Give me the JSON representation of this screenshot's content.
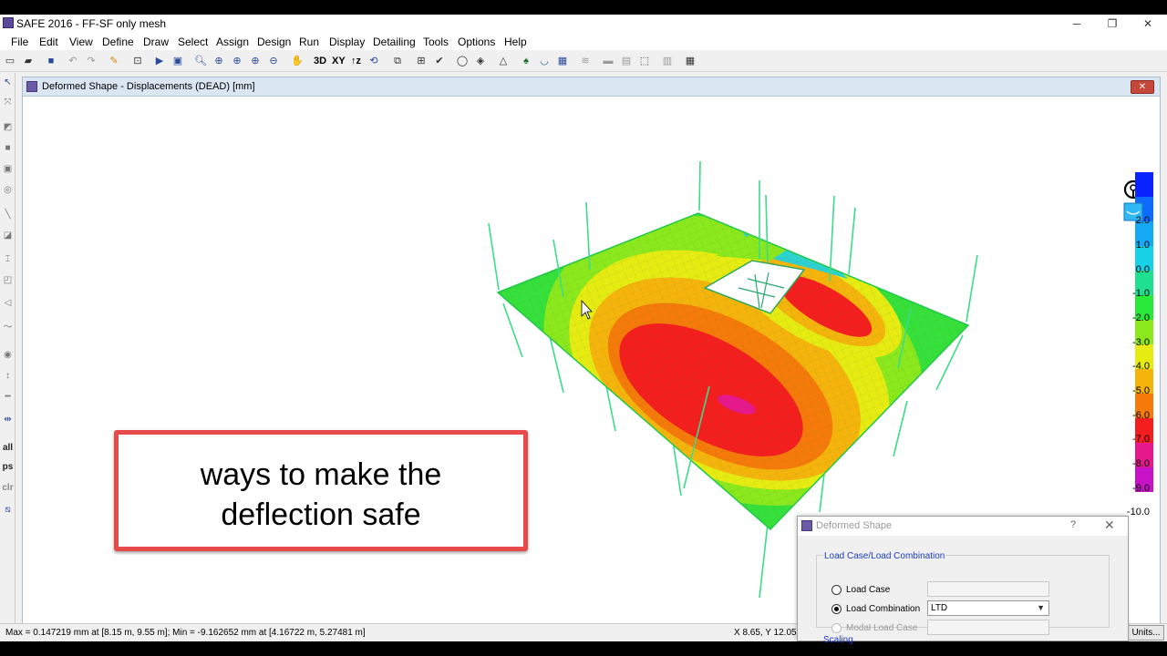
{
  "window": {
    "title": "SAFE 2016 - FF-SF only mesh",
    "minimize": "─",
    "restore": "❐",
    "close": "✕"
  },
  "menu": [
    "File",
    "Edit",
    "View",
    "Define",
    "Draw",
    "Select",
    "Assign",
    "Design",
    "Run",
    "Display",
    "Detailing",
    "Tools",
    "Options",
    "Help"
  ],
  "toolbar": {
    "view_3d": "3D",
    "view_xy": "XY",
    "view_xz": "↑z"
  },
  "left_toolbar": {
    "all": "all",
    "ps": "ps",
    "clr": "clr"
  },
  "view_window": {
    "title": "Deformed Shape - Displacements (DEAD)  [mm]",
    "close": "✕"
  },
  "legend": {
    "labels": [
      "2.0",
      "1.0",
      "0.0",
      "-1.0",
      "-2.0",
      "-3.0",
      "-4.0",
      "-5.0",
      "-6.0",
      "-7.0",
      "-8.0",
      "-9.0",
      "-10.0"
    ],
    "colors": [
      "#0b24ff",
      "#0d6cff",
      "#14a8f5",
      "#17d2e6",
      "#1ee08f",
      "#28e83a",
      "#8be81c",
      "#e6ec12",
      "#f5b40c",
      "#f57a0a",
      "#f51e1e",
      "#e6188c",
      "#c812c8"
    ]
  },
  "callout": {
    "line1": "ways to make the",
    "line2": "deflection safe"
  },
  "status": {
    "left": "Max = 0.147219 mm at [8.15 m, 9.55 m];  Min = -9.162652 mm at [4.16722 m, 5.27481 m]",
    "coords": "X 8.65,  Y 12.05,",
    "units": "Units..."
  },
  "dialog": {
    "title": "Deformed Shape",
    "help": "?",
    "close": "✕",
    "group_label": "Load Case/Load Combination",
    "load_case_label": "Load Case",
    "load_combination_label": "Load Combination",
    "load_combination_value": "LTD",
    "modal_label": "Modal Load Case",
    "scaling_label": "Scaling"
  }
}
